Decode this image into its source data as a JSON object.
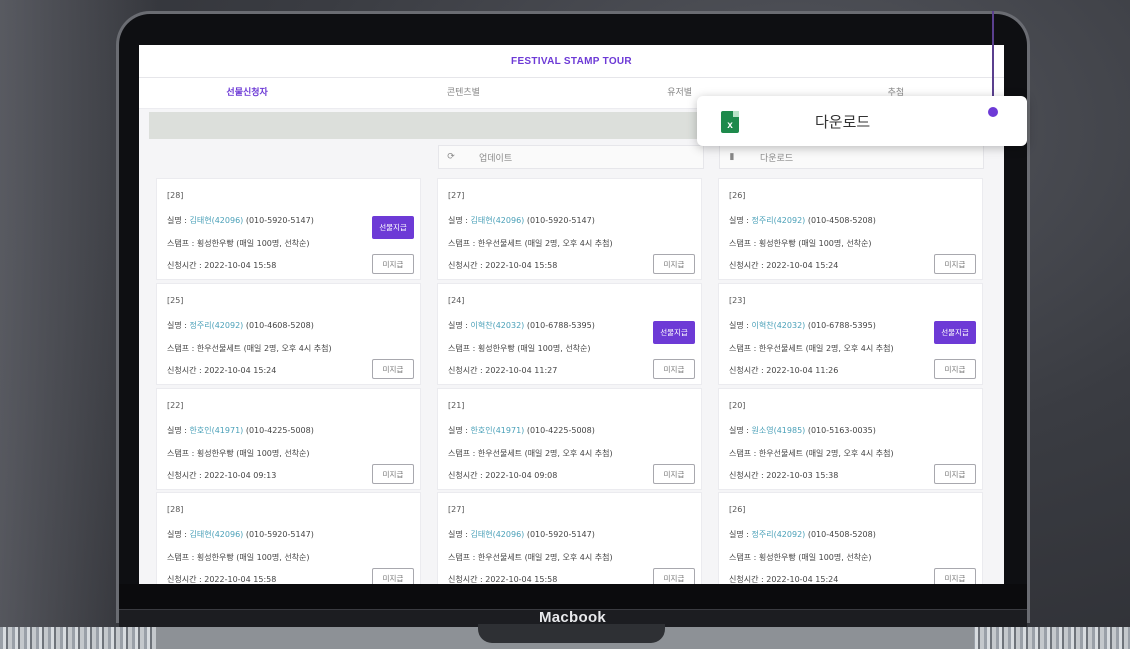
{
  "app": {
    "title": "FESTIVAL STAMP TOUR"
  },
  "tabs": [
    "선물신청자",
    "콘텐츠별",
    "유저별",
    "추첨"
  ],
  "toolbar": {
    "update_label": "업데이트",
    "download_label": "다운로드"
  },
  "popup": {
    "label": "다운로드"
  },
  "device": {
    "brand": "Macbook"
  },
  "labels": {
    "name": "실명 : ",
    "stamp": "스탬프 : ",
    "time": "신청시간 : ",
    "give": "선물지급",
    "notgiven": "미지급"
  },
  "cards": [
    {
      "id": "[28]",
      "name": "김태현(42096)",
      "phone": "(010-5920-5147)",
      "stamp": "횡성한우빵 (매일 100명, 선착순)",
      "time": "2022-10-04 15:58",
      "give": true
    },
    {
      "id": "[27]",
      "name": "김태현(42096)",
      "phone": "(010-5920-5147)",
      "stamp": "한우선물세트 (매일 2명, 오후 4시 추첨)",
      "time": "2022-10-04 15:58",
      "give": false
    },
    {
      "id": "[26]",
      "name": "정주리(42092)",
      "phone": "(010-4508-5208)",
      "stamp": "횡성한우빵 (매일 100명, 선착순)",
      "time": "2022-10-04 15:24",
      "give": false
    },
    {
      "id": "[25]",
      "name": "정주리(42092)",
      "phone": "(010-4608-5208)",
      "stamp": "한우선물세트 (매일 2명, 오후 4시 추첨)",
      "time": "2022-10-04 15:24",
      "give": false
    },
    {
      "id": "[24]",
      "name": "이혁찬(42032)",
      "phone": "(010-6788-5395)",
      "stamp": "횡성한우빵 (매일 100명, 선착순)",
      "time": "2022-10-04 11:27",
      "give": true
    },
    {
      "id": "[23]",
      "name": "이혁찬(42032)",
      "phone": "(010-6788-5395)",
      "stamp": "한우선물세트 (매일 2명, 오후 4시 추첨)",
      "time": "2022-10-04 11:26",
      "give": true
    },
    {
      "id": "[22]",
      "name": "한호인(41971)",
      "phone": "(010-4225-5008)",
      "stamp": "횡성한우빵 (매일 100명, 선착순)",
      "time": "2022-10-04 09:13",
      "give": false
    },
    {
      "id": "[21]",
      "name": "한호인(41971)",
      "phone": "(010-4225-5008)",
      "stamp": "한우선물세트 (매일 2명, 오후 4시 추첨)",
      "time": "2022-10-04 09:08",
      "give": false
    },
    {
      "id": "[20]",
      "name": "원소영(41985)",
      "phone": "(010-5163-0035)",
      "stamp": "한우선물세트 (매일 2명, 오후 4시 추첨)",
      "time": "2022-10-03 15:38",
      "give": false
    },
    {
      "id": "[28]",
      "name": "김태현(42096)",
      "phone": "(010-5920-5147)",
      "stamp": "횡성한우빵 (매일 100명, 선착순)",
      "time": "2022-10-04 15:58",
      "give": false
    },
    {
      "id": "[27]",
      "name": "김태현(42096)",
      "phone": "(010-5920-5147)",
      "stamp": "한우선물세트 (매일 2명, 오후 4시 추첨)",
      "time": "2022-10-04 15:58",
      "give": false
    },
    {
      "id": "[26]",
      "name": "정주리(42092)",
      "phone": "(010-4508-5208)",
      "stamp": "횡성한우빵 (매일 100명, 선착순)",
      "time": "2022-10-04 15:24",
      "give": false
    }
  ],
  "colors": {
    "accent": "#6d3ad6",
    "name_link": "#4aa0b8",
    "excel": "#1e8a4c"
  }
}
